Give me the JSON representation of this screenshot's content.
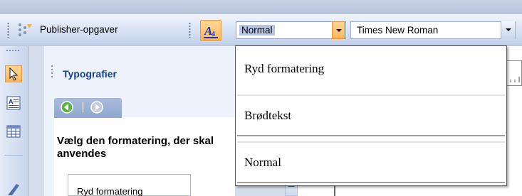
{
  "toolbar": {
    "publisher_tasks_label": "Publisher-opgaver",
    "style_value": "Normal",
    "font_value": "Times New Roman"
  },
  "styles_panel": {
    "title": "Typografier",
    "instruction": "Vælg den formatering, der skal anvendes",
    "list_first_item": "Ryd formatering"
  },
  "style_dropdown": {
    "items": [
      "Ryd formatering",
      "Brødtekst",
      "Normal"
    ]
  },
  "icons": {
    "task_pane": "task-pane-icon",
    "styles": "styles-icon",
    "pointer": "pointer-icon",
    "text_box": "text-box-icon",
    "table": "table-icon",
    "back": "back-icon",
    "forward": "forward-icon"
  },
  "colors": {
    "accent_orange": "#ffb65a",
    "panel_title": "#15428b",
    "toolbar_blue": "#c3d2ec"
  }
}
